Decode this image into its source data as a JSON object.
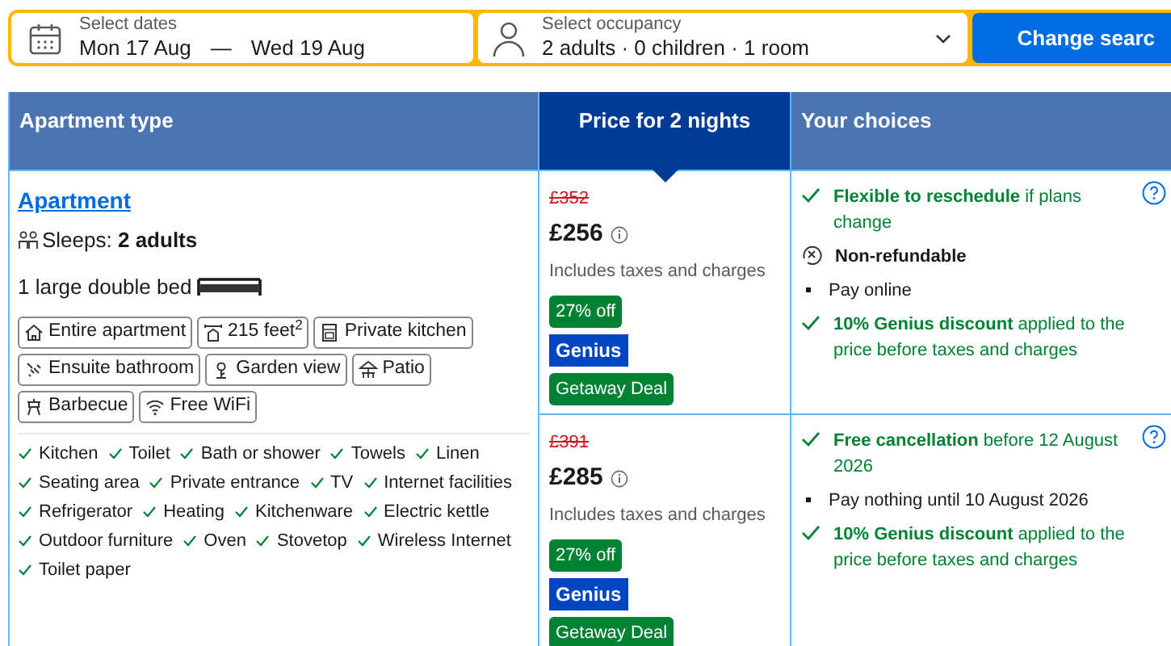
{
  "search": {
    "dates": {
      "label": "Select dates",
      "checkin": "Mon 17 Aug",
      "separator": "—",
      "checkout": "Wed 19 Aug"
    },
    "occupancy": {
      "label": "Select occupancy",
      "value": "2 adults · 0 children · 1 room"
    },
    "button": "Change searc"
  },
  "table": {
    "columns": [
      {
        "label": "Apartment type",
        "selected": false
      },
      {
        "label": "Price for 2 nights",
        "selected": true
      },
      {
        "label": "Your choices",
        "selected": false
      }
    ],
    "apartment": {
      "name": "Apartment",
      "sleeps": "Sleeps: **2 adults**",
      "bed": "1 large double bed",
      "features": [
        "Entire apartment",
        "215 feet$^{2}$",
        "Private kitchen",
        "Ensuite bathroom",
        "Garden view",
        "Patio",
        "Barbecue",
        "Free WiFi"
      ],
      "facilities": [
        "Kitchen",
        "Toilet",
        "Bath or shower",
        "Towels",
        "Linen",
        "Seating area",
        "Private entrance",
        "TV",
        "Internet facilities",
        "Refrigerator",
        "Heating",
        "Kitchenware",
        "Electric kettle",
        "Outdoor furniture",
        "Oven",
        "Stovetop",
        "Wireless Internet",
        "Toilet paper"
      ]
    },
    "rows": [
      {
        "old_price": "£352",
        "price": "£256",
        "note": "Includes taxes and charges",
        "badges": [
          {
            "kind": "deal",
            "text": "27% off"
          },
          {
            "kind": "genius",
            "text": "Genius"
          },
          {
            "kind": "deal",
            "text": "Getaway Deal"
          }
        ],
        "choices": [
          {
            "kind": "check",
            "text": "**Flexible to reschedule** if plans change"
          },
          {
            "kind": "nonrefundable",
            "text": "**Non-refundable**"
          },
          {
            "kind": "bullet",
            "text": "Pay online"
          },
          {
            "kind": "check",
            "text": "**10% Genius discount** applied to the price before taxes and charges"
          }
        ]
      },
      {
        "old_price": "£391",
        "price": "£285",
        "note": "Includes taxes and charges",
        "badges": [
          {
            "kind": "deal",
            "text": "27% off"
          },
          {
            "kind": "genius",
            "text": "Genius"
          },
          {
            "kind": "deal",
            "text": "Getaway Deal"
          }
        ],
        "choices": [
          {
            "kind": "check",
            "text": "**Free cancellation** before 12 August 2026"
          },
          {
            "kind": "bullet",
            "text": "Pay nothing until 10 August 2026"
          },
          {
            "kind": "check",
            "text": "**10% Genius discount** applied to the price before taxes and charges"
          }
        ]
      }
    ]
  }
}
